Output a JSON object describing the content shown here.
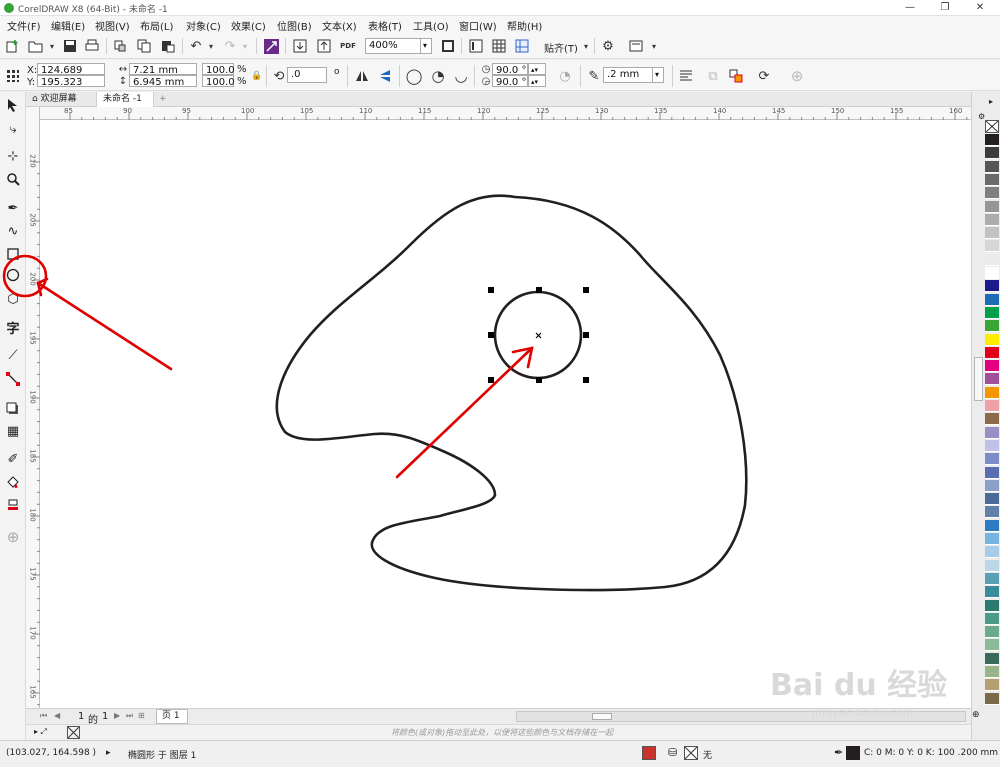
{
  "window": {
    "title": "CorelDRAW X8 (64-Bit) - 未命名 -1",
    "minimize": "—",
    "restore": "❐",
    "close": "✕"
  },
  "menu": [
    "文件(F)",
    "编辑(E)",
    "视图(V)",
    "布局(L)",
    "对象(C)",
    "效果(C)",
    "位图(B)",
    "文本(X)",
    "表格(T)",
    "工具(O)",
    "窗口(W)",
    "帮助(H)"
  ],
  "toolbar": {
    "zoom": "400%",
    "pdf_label": "PDF",
    "snap_label": "贴齐(T)"
  },
  "properties": {
    "x_label": "X:",
    "x_value": "124.689 mm",
    "y_label": "Y:",
    "y_value": "195.323 mm",
    "width": "7.21 mm",
    "height": "6.945 mm",
    "scale_x": "100.0",
    "scale_y": "100.0",
    "percent": "%",
    "rotation": ".0",
    "rotation_unit": "o",
    "start_angle": "90.0 °",
    "end_angle": "90.0 °",
    "outline_width": ".2 mm"
  },
  "tabs": {
    "welcome": "欢迎屏幕",
    "document": "未命名 -1",
    "add": "+"
  },
  "rulers": {
    "h_ticks": [
      "85",
      "90",
      "95",
      "100",
      "105",
      "110",
      "115",
      "120",
      "125",
      "130",
      "135",
      "140",
      "145",
      "150",
      "155",
      "160"
    ],
    "v_ticks": [
      "210",
      "205",
      "200",
      "195",
      "190",
      "185",
      "180",
      "175",
      "170",
      "165"
    ],
    "unit": "毫米"
  },
  "pagebar": {
    "page_index": "1",
    "of_label": "的",
    "page_total": "1",
    "page_tab": "页 1"
  },
  "colorstrip": {
    "hint": "将颜色(或对象)拖动至此处，以便将这些颜色与文档存储在一起"
  },
  "status": {
    "coords": "(103.027, 164.598 )",
    "arrow": "▸",
    "object_info": "椭圆形 于 图层 1",
    "fill_none": "无",
    "outline_info": "C: 0 M: 0 Y: 0 K: 100  .200 mm"
  },
  "watermark": {
    "brand": "Bai du 经验",
    "url": "jingyan.baidu.com"
  },
  "palette": [
    "#231f20",
    "#3d3d3d",
    "#555555",
    "#6b6b6b",
    "#808080",
    "#969696",
    "#acacac",
    "#c2c2c2",
    "#d6d6d6",
    "#ebebeb",
    "#ffffff",
    "#1b1b8c",
    "#1e6ab4",
    "#00a04a",
    "#3ba535",
    "#ffed00",
    "#e2001a",
    "#e4007f",
    "#a0509a",
    "#f39800",
    "#f0a1a8",
    "#8c6a4a",
    "#9b8ec4",
    "#c0c0e8",
    "#7b8cc8",
    "#5a6fb2",
    "#8aa0c8",
    "#4a6a9a",
    "#6080a8",
    "#2e7bc4",
    "#78b4e0",
    "#a8cce8",
    "#bcd8e8",
    "#5aa0b4",
    "#3a8c9a",
    "#2a7a72",
    "#4a9a8a",
    "#6aaa8a",
    "#8abc9a",
    "#3a6a5a",
    "#9ab48a",
    "#b4a070",
    "#7a6a4a"
  ],
  "shapes": {
    "accent": "#e00000",
    "stroke": "#231f20"
  }
}
